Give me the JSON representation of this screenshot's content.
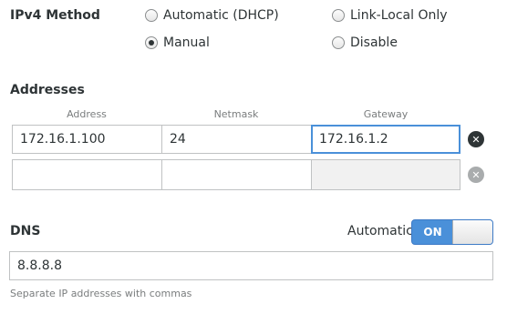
{
  "ipv4": {
    "label": "IPv4 Method",
    "options": [
      {
        "label": "Automatic (DHCP)",
        "selected": false
      },
      {
        "label": "Link-Local Only",
        "selected": false
      },
      {
        "label": "Manual",
        "selected": true
      },
      {
        "label": "Disable",
        "selected": false
      }
    ]
  },
  "addresses": {
    "label": "Addresses",
    "columns": [
      "Address",
      "Netmask",
      "Gateway"
    ],
    "rows": [
      {
        "address": "172.16.1.100",
        "netmask": "24",
        "gateway": "172.16.1.2"
      },
      {
        "address": "",
        "netmask": "",
        "gateway": ""
      }
    ]
  },
  "dns": {
    "label": "DNS",
    "automatic_label": "Automatic",
    "switch_state": "ON",
    "value": "8.8.8.8",
    "hint": "Separate IP addresses with commas"
  },
  "colors": {
    "accent": "#4a90d9",
    "text": "#2e3436",
    "dim": "#7a7d7e"
  },
  "icons": {
    "remove": "remove-circle-icon",
    "radio": "radio-button-icon"
  }
}
